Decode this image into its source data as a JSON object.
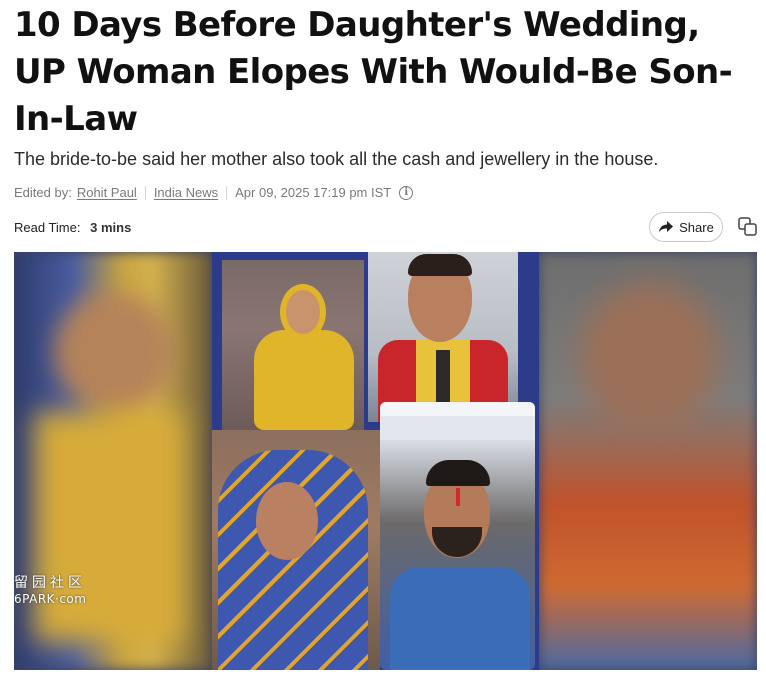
{
  "article": {
    "headline": "10 Days Before Daughter's Wedding, UP Woman Elopes With Would-Be Son-In-Law",
    "subheadline": "The bride-to-be said her mother also took all the cash and jewellery in the house.",
    "meta": {
      "edited_by_label": "Edited by:",
      "author": "Rohit Paul",
      "section": "India News",
      "date": "Apr 09, 2025 17:19 pm IST"
    },
    "read_time_label": "Read Time:",
    "read_time_value": "3 mins"
  },
  "actions": {
    "share_label": "Share"
  },
  "image": {
    "watermark_cjk": "留园社区",
    "watermark_latin": "6PARK·com"
  },
  "icons": {
    "info": "info-icon",
    "share": "share-arrow-icon",
    "copy": "copy-icon"
  }
}
